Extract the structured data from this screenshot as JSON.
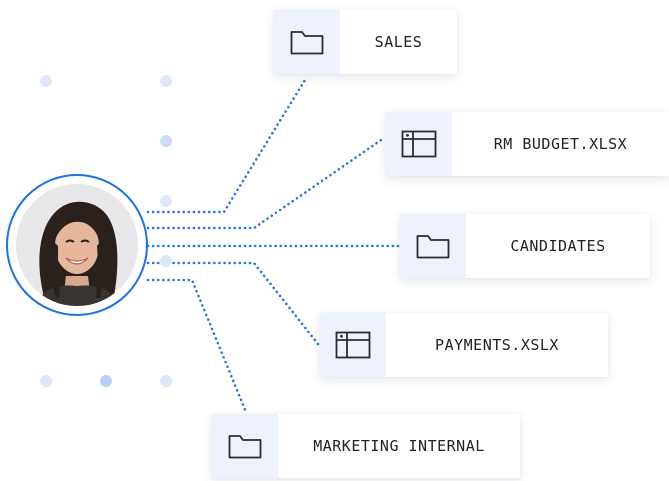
{
  "files": [
    {
      "label": "SALES",
      "icon": "folder-icon"
    },
    {
      "label": "RM BUDGET.XLSX",
      "icon": "spreadsheet-icon"
    },
    {
      "label": "CANDIDATES",
      "icon": "folder-icon"
    },
    {
      "label": "PAYMENTS.XSLX",
      "icon": "spreadsheet-icon"
    },
    {
      "label": "MARKETING INTERNAL",
      "icon": "folder-icon"
    }
  ],
  "user": {
    "avatar": "user-avatar"
  },
  "colors": {
    "connector": "#1a73e8",
    "ring": "#1a73e8",
    "icon_bg": "#edf2fd",
    "dot": "#dfe8fb"
  }
}
